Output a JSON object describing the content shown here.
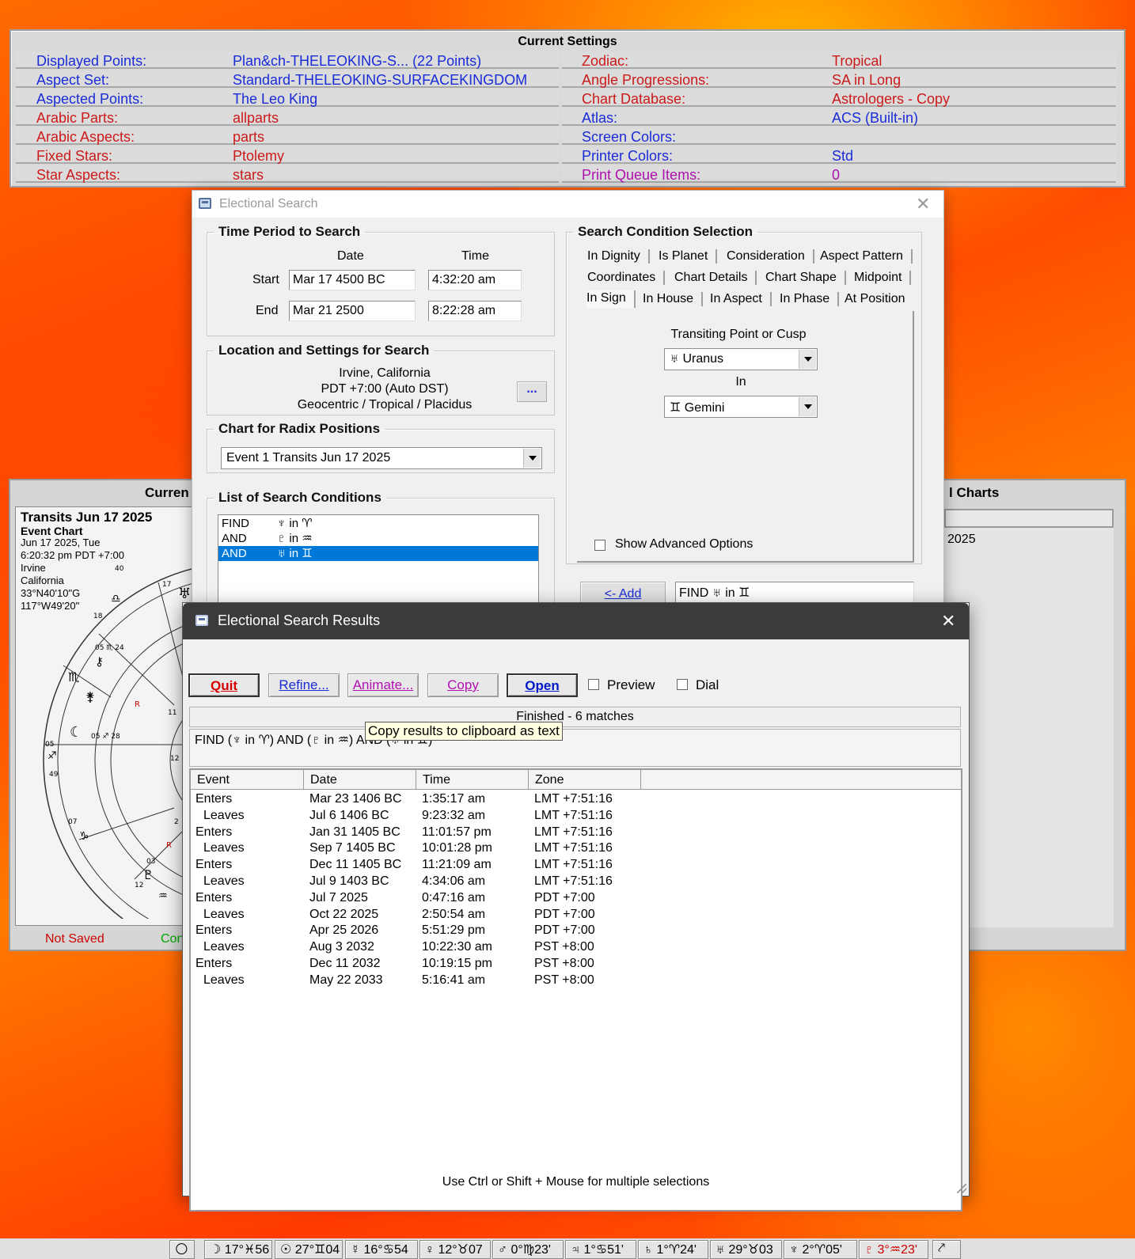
{
  "settings": {
    "title": "Current Settings",
    "left": [
      {
        "label": "Displayed Points:",
        "value": "Plan&ch-THELEOKING-S...  (22 Points)"
      },
      {
        "label": "Aspect Set:",
        "value": "Standard-THELEOKING-SURFACEKINGDOM"
      },
      {
        "label": "Aspected Points:",
        "value": "The Leo King"
      },
      {
        "label": "Arabic Parts:",
        "value": "allparts"
      },
      {
        "label": "Arabic Aspects:",
        "value": "parts"
      },
      {
        "label": "Fixed Stars:",
        "value": "Ptolemy"
      },
      {
        "label": "Star Aspects:",
        "value": "stars"
      }
    ],
    "right": [
      {
        "label": "Zodiac:",
        "value": "Tropical"
      },
      {
        "label": "Angle Progressions:",
        "value": "SA in Long"
      },
      {
        "label": "Chart Database:",
        "value": "Astrologers - Copy"
      },
      {
        "label": "Atlas:",
        "value": "ACS  (Built-in)"
      },
      {
        "label": "Screen Colors:",
        "value": ""
      },
      {
        "label": "Printer Colors:",
        "value": "Std"
      },
      {
        "label": "Print Queue Items:",
        "value": "0"
      }
    ]
  },
  "chart_window": {
    "title_left": "Curren",
    "title_right": "l Charts",
    "right_list_item": "2025",
    "chart_title": "Transits Jun 17 2025",
    "chart_subtitle": "Event Chart",
    "info": [
      "Jun 17 2025, Tue",
      "6:20:32 pm  PDT +7:00",
      "Irvine",
      "California",
      "33°N40'10\"G",
      "117°W49'20\""
    ],
    "status_left": "Not Saved",
    "status_right": "Con"
  },
  "search": {
    "title": "Electional Search",
    "time_period": {
      "legend": "Time Period to Search",
      "date_header": "Date",
      "time_header": "Time",
      "start_label": "Start",
      "end_label": "End",
      "start_date": "Mar 17 4500 BC",
      "start_time": "4:32:20 am",
      "end_date": "Mar 21 2500",
      "end_time": "8:22:28 am"
    },
    "location": {
      "legend": "Location and Settings for Search",
      "line1": "Irvine, California",
      "line2": "PDT +7:00  (Auto DST)",
      "line3": "Geocentric / Tropical / Placidus",
      "more_button": "..."
    },
    "radix": {
      "legend": "Chart for Radix Positions",
      "selected": "Event 1 Transits Jun 17 2025"
    },
    "conditions": {
      "legend": "List of Search Conditions",
      "items": [
        {
          "op": "FIND",
          "text": "♆ in ♈"
        },
        {
          "op": "AND",
          "text": "♇ in ♒"
        },
        {
          "op": "AND",
          "text": "♅ in ♊"
        }
      ]
    },
    "selection": {
      "legend": "Search Condition Selection",
      "tabs_row1": [
        "In Dignity",
        "Is Planet",
        "Consideration",
        "Aspect Pattern"
      ],
      "tabs_row2": [
        "Coordinates",
        "Chart Details",
        "Chart Shape",
        "Midpoint"
      ],
      "tabs_row3": [
        "In Sign",
        "In House",
        "In Aspect",
        "In Phase",
        "At Position"
      ],
      "transiting_label": "Transiting Point or Cusp",
      "transiting_value": "♅ Uranus",
      "in_label": "In",
      "sign_value": "♊ Gemini",
      "advanced_label": "Show Advanced Options",
      "add_button": "<- Add",
      "preview_text": "FIND   ♅ in ♊"
    }
  },
  "results": {
    "title": "Electional Search Results",
    "buttons": {
      "quit": "Quit",
      "refine": "Refine...",
      "animate": "Animate...",
      "copy": "Copy",
      "open": "Open"
    },
    "preview_label": "Preview",
    "dial_label": "Dial",
    "status": "Finished - 6 matches",
    "query": "FIND  (♆ in ♈)  AND  (♇ in ♒)  AND  (♅ in ♊)",
    "tooltip": "Copy results to clipboard as text",
    "columns": [
      "Event",
      "Date",
      "Time",
      "Zone"
    ],
    "rows": [
      [
        "Enters",
        "Mar 23 1406 BC",
        "1:35:17 am",
        "LMT +7:51:16"
      ],
      [
        "Leaves",
        "Jul 6 1406 BC",
        "9:23:32 am",
        "LMT +7:51:16"
      ],
      [
        "Enters",
        "Jan 31 1405 BC",
        "11:01:57 pm",
        "LMT +7:51:16"
      ],
      [
        "Leaves",
        "Sep 7 1405 BC",
        "10:01:28 pm",
        "LMT +7:51:16"
      ],
      [
        "Enters",
        "Dec 11 1405 BC",
        "11:21:09 am",
        "LMT +7:51:16"
      ],
      [
        "Leaves",
        "Jul 9 1403 BC",
        "4:34:06 am",
        "LMT +7:51:16"
      ],
      [
        "Enters",
        "Jul 7 2025",
        "0:47:16 am",
        "PDT +7:00"
      ],
      [
        "Leaves",
        "Oct 22 2025",
        "2:50:54 am",
        "PDT +7:00"
      ],
      [
        "Enters",
        "Apr 25 2026",
        "5:51:29 pm",
        "PDT +7:00"
      ],
      [
        "Leaves",
        "Aug 3 2032",
        "10:22:30 am",
        "PST +8:00"
      ],
      [
        "Enters",
        "Dec 11 2032",
        "10:19:15 pm",
        "PST +8:00"
      ],
      [
        "Leaves",
        "May 22 2033",
        "5:16:41 am",
        "PST +8:00"
      ]
    ],
    "footer": "Use Ctrl or Shift + Mouse for multiple selections"
  },
  "bottom_bar": [
    "☽ 17°♓56",
    "☉ 27°♊04",
    "☿ 16°♋54",
    "♀ 12°♉07",
    "♂ 0°♍23'",
    "♃ 1°♋51'",
    "♄ 1°♈24'",
    "♅ 29°♉03",
    "♆ 2°♈05'",
    "♇ 3°♒23'"
  ]
}
